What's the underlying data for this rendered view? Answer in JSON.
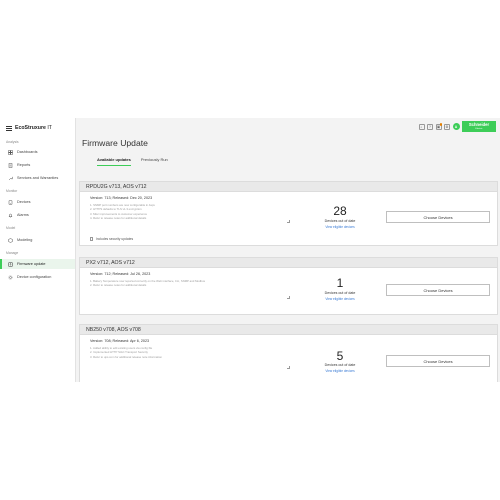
{
  "app": {
    "brand_prefix": "EcoStruxure",
    "brand_suffix": "IT",
    "logo_text": "Schneider",
    "logo_sub": "Electric",
    "avatar_initial": "A",
    "accent": "#3dcd58"
  },
  "sidebar": {
    "sections": {
      "analysis": "Analysis",
      "monitor": "Monitor",
      "model": "Model",
      "manage": "Manage"
    },
    "items": [
      {
        "label": "Dashboards",
        "icon": "dashboard-icon"
      },
      {
        "label": "Reports",
        "icon": "report-icon"
      },
      {
        "label": "Services and Warranties",
        "icon": "wrench-icon"
      },
      {
        "label": "Devices",
        "icon": "device-icon"
      },
      {
        "label": "Alarms",
        "icon": "bell-icon"
      },
      {
        "label": "Modeling",
        "icon": "modeling-icon"
      },
      {
        "label": "Firmware update",
        "icon": "firmware-icon"
      },
      {
        "label": "Device configuration",
        "icon": "config-icon"
      }
    ]
  },
  "header": {
    "icons": [
      "search-icon",
      "help-icon",
      "notification-icon",
      "settings-icon"
    ]
  },
  "main": {
    "title": "Firmware Update",
    "tabs": [
      {
        "label": "Available updates",
        "active": true
      },
      {
        "label": "Previously Run",
        "active": false
      }
    ],
    "cards": [
      {
        "name": "RPDU2G v713, AOS v712",
        "version": "Version: 713; Released: Dec 20, 2023",
        "notes": [
          "1. SNMP port numbers are now configurable in Aspx",
          "2. HTTPS defaults to TLS v1.3 encryption",
          "3. Misc improvements to customer experience",
          "4. Refer to release notes for additional details"
        ],
        "count": "28",
        "count_label": "Devices out of date",
        "link": "View eligible devices",
        "button": "Choose Devices",
        "security_label": "Includes security updates"
      },
      {
        "name": "PX2 v712, AOS v712",
        "version": "Version: 712; Released: Jul 26, 2023",
        "notes": [
          "1. Battery Temperature now reported correctly on the Web interface, CLI, SNMP and Modbus",
          "2. Refer to release notes for additional details"
        ],
        "count": "1",
        "count_label": "Devices out of date",
        "link": "View eligible devices",
        "button": "Choose Devices"
      },
      {
        "name": "NB250 v708, AOS v708",
        "version": "Version: 708; Released: Apr 6, 2023",
        "notes": [
          "1. Added ability to edit existing users via config file",
          "2. Implemented HTTP Strict Transport Security",
          "3. Refer to ups.com for additional release note information"
        ],
        "count": "5",
        "count_label": "Devices out of date",
        "link": "View eligible devices",
        "button": "Choose Devices"
      }
    ]
  }
}
